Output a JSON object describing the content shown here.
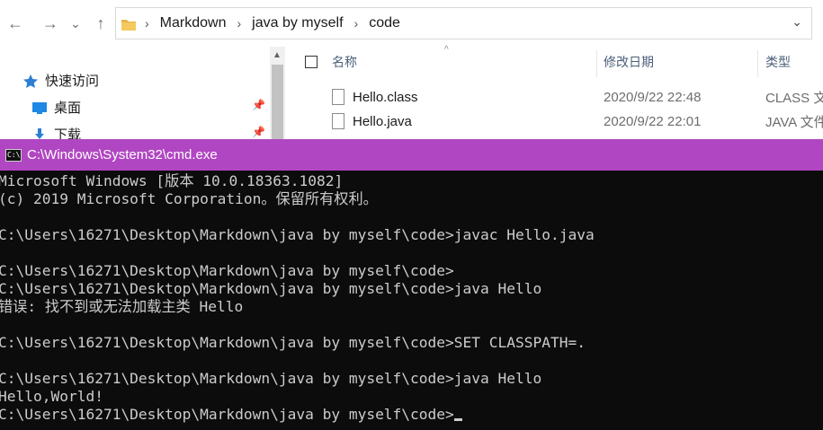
{
  "explorer": {
    "nav": {
      "back": "←",
      "forward": "→",
      "recent": "⌄",
      "up": "↑"
    },
    "breadcrumb": [
      "Markdown",
      "java by myself",
      "code"
    ],
    "sidebar": {
      "items": [
        {
          "label": "快速访问",
          "icon": "star-icon"
        },
        {
          "label": "桌面",
          "icon": "desktop-icon"
        },
        {
          "label": "下载",
          "icon": "download-icon"
        }
      ]
    },
    "columns": {
      "name": "名称",
      "date": "修改日期",
      "type": "类型"
    },
    "files": [
      {
        "name": "Hello.class",
        "date": "2020/9/22 22:48",
        "type": "CLASS 文"
      },
      {
        "name": "Hello.java",
        "date": "2020/9/22 22:01",
        "type": "JAVA 文件"
      }
    ]
  },
  "cmd": {
    "title": "C:\\Windows\\System32\\cmd.exe",
    "title_bar_color": "#b146c2",
    "lines": [
      "Microsoft Windows [版本 10.0.18363.1082]",
      "(c) 2019 Microsoft Corporation。保留所有权利。",
      "",
      "C:\\Users\\16271\\Desktop\\Markdown\\java by myself\\code>javac Hello.java",
      "",
      "C:\\Users\\16271\\Desktop\\Markdown\\java by myself\\code>",
      "C:\\Users\\16271\\Desktop\\Markdown\\java by myself\\code>java Hello",
      "错误: 找不到或无法加载主类 Hello",
      "",
      "C:\\Users\\16271\\Desktop\\Markdown\\java by myself\\code>SET CLASSPATH=.",
      "",
      "C:\\Users\\16271\\Desktop\\Markdown\\java by myself\\code>java Hello",
      "Hello,World!"
    ],
    "prompt": "C:\\Users\\16271\\Desktop\\Markdown\\java by myself\\code>"
  }
}
